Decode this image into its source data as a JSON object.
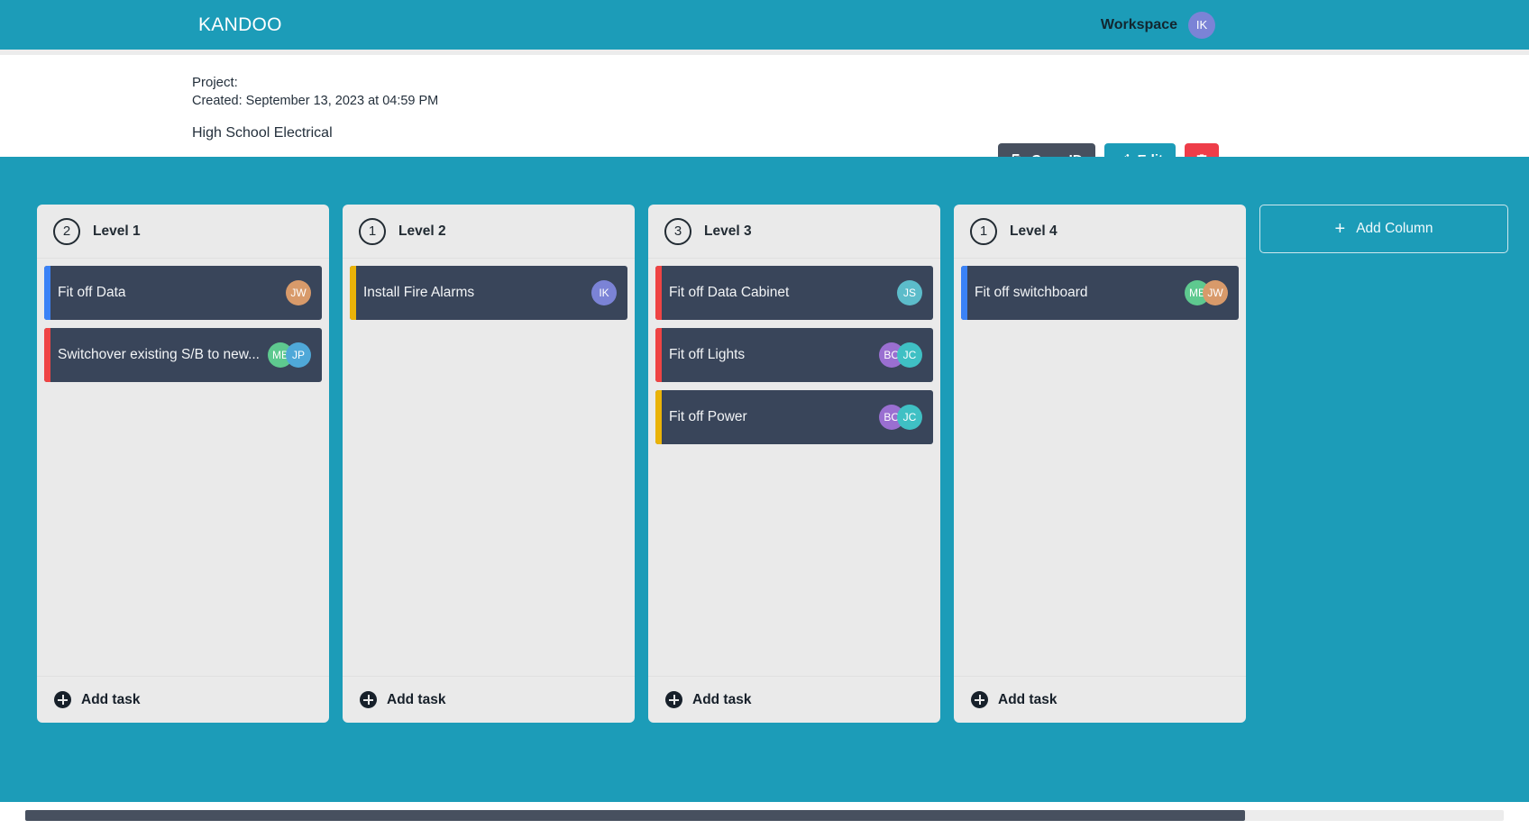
{
  "colors": {
    "brand_teal": "#1c9cb8",
    "card_dark": "#39455a",
    "column_bg": "#eaeaea",
    "danger_red": "#ee3d49",
    "dark_slate": "#47505f"
  },
  "topnav": {
    "brand": "KANDOO",
    "workspace_label": "Workspace",
    "user_avatar": {
      "initials": "IK",
      "color": "#7b83d6"
    }
  },
  "project": {
    "label": "Project:",
    "created": "Created: September 13, 2023 at 04:59 PM",
    "name": "High School Electrical",
    "actions": {
      "copy_id": "Copy ID",
      "edit": "Edit",
      "delete_icon": "trash-icon",
      "copy_icon": "copy-icon",
      "edit_icon": "pencil-icon"
    }
  },
  "board": {
    "add_column_label": "Add Column",
    "add_task_label": "Add task",
    "columns": [
      {
        "title": "Level 1",
        "count": "2",
        "tasks": [
          {
            "title": "Fit off Data",
            "bar_color": "#3b82f6",
            "avatars": [
              {
                "initials": "JW",
                "color": "#d89a6a"
              }
            ]
          },
          {
            "title": "Switchover existing S/B to new...",
            "bar_color": "#ef4444",
            "avatars": [
              {
                "initials": "MB",
                "color": "#5ec98f"
              },
              {
                "initials": "JP",
                "color": "#4fa8d8"
              }
            ]
          }
        ]
      },
      {
        "title": "Level 2",
        "count": "1",
        "tasks": [
          {
            "title": "Install Fire Alarms",
            "bar_color": "#eab308",
            "avatars": [
              {
                "initials": "IK",
                "color": "#7b83d6"
              }
            ]
          }
        ]
      },
      {
        "title": "Level 3",
        "count": "3",
        "tasks": [
          {
            "title": "Fit off Data Cabinet",
            "bar_color": "#ef4444",
            "avatars": [
              {
                "initials": "JS",
                "color": "#5cbcca"
              }
            ]
          },
          {
            "title": "Fit off Lights",
            "bar_color": "#ef4444",
            "avatars": [
              {
                "initials": "BO",
                "color": "#9a6fd1"
              },
              {
                "initials": "JC",
                "color": "#3fc0c4"
              }
            ]
          },
          {
            "title": "Fit off Power",
            "bar_color": "#eab308",
            "avatars": [
              {
                "initials": "BO",
                "color": "#9a6fd1"
              },
              {
                "initials": "JC",
                "color": "#3fc0c4"
              }
            ]
          }
        ]
      },
      {
        "title": "Level 4",
        "count": "1",
        "tasks": [
          {
            "title": "Fit off switchboard",
            "bar_color": "#3b82f6",
            "avatars": [
              {
                "initials": "MB",
                "color": "#5ec98f"
              },
              {
                "initials": "JW",
                "color": "#d89a6a"
              }
            ]
          }
        ]
      }
    ]
  }
}
